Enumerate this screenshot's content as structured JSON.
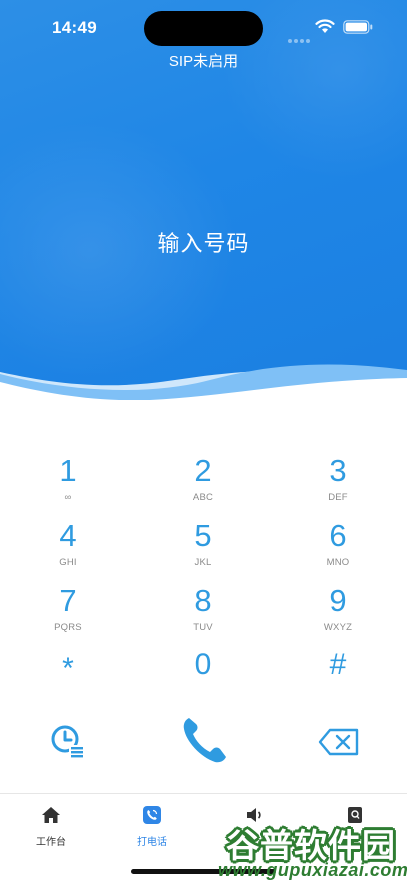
{
  "status_bar": {
    "time": "14:49"
  },
  "header": {
    "sip_status": "SIP未启用",
    "number_placeholder": "输入号码"
  },
  "keypad": {
    "keys": [
      {
        "digit": "1",
        "letters": "∞"
      },
      {
        "digit": "2",
        "letters": "ABC"
      },
      {
        "digit": "3",
        "letters": "DEF"
      },
      {
        "digit": "4",
        "letters": "GHI"
      },
      {
        "digit": "5",
        "letters": "JKL"
      },
      {
        "digit": "6",
        "letters": "MNO"
      },
      {
        "digit": "7",
        "letters": "PQRS"
      },
      {
        "digit": "8",
        "letters": "TUV"
      },
      {
        "digit": "9",
        "letters": "WXYZ"
      },
      {
        "digit": "*",
        "letters": ""
      },
      {
        "digit": "0",
        "letters": ""
      },
      {
        "digit": "#",
        "letters": ""
      }
    ]
  },
  "actions": {
    "history_icon": "clock-list-icon",
    "call_icon": "phone-icon",
    "delete_icon": "backspace-icon"
  },
  "tabbar": {
    "tabs": [
      {
        "label": "工作台",
        "icon": "home-icon",
        "active": false
      },
      {
        "label": "打电话",
        "icon": "phone-app-icon",
        "active": true
      },
      {
        "label": "",
        "icon": "speaker-icon",
        "active": false
      },
      {
        "label": "",
        "icon": "contacts-icon",
        "active": false
      }
    ]
  },
  "watermark": {
    "title": "谷普软件园",
    "url": "www.gupuxiazai.com"
  },
  "colors": {
    "header_blue": "#1f86e6",
    "accent_blue": "#2f9be0",
    "active_tab": "#2f86e6"
  }
}
